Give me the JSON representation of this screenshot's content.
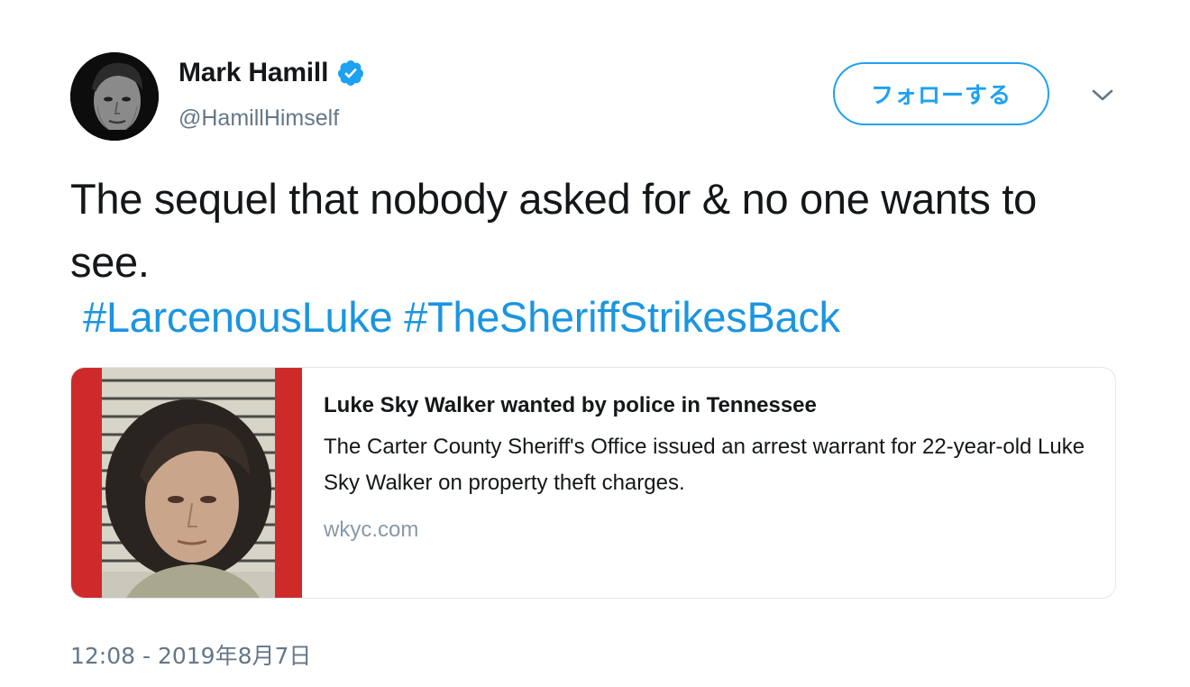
{
  "user": {
    "name": "Mark Hamill",
    "handle": "@HamillHimself",
    "verified": true
  },
  "follow_label": "フォローする",
  "tweet": {
    "text": "The sequel that nobody asked for & no one wants to see.",
    "hashtags": [
      "#LarcenousLuke",
      "#TheSheriffStrikesBack"
    ]
  },
  "card": {
    "title": "Luke Sky Walker wanted by police in Tennessee",
    "description": "The Carter County Sheriff's Office issued an arrest warrant for 22-year-old Luke Sky Walker on property theft charges.",
    "domain": "wkyc.com"
  },
  "timestamp": "12:08 - 2019年8月7日",
  "colors": {
    "accent": "#1da1f2",
    "hashtag": "#1b95e0",
    "secondary_text": "#657786"
  },
  "icons": {
    "verified": "verified-badge-icon",
    "menu": "chevron-down-icon"
  }
}
